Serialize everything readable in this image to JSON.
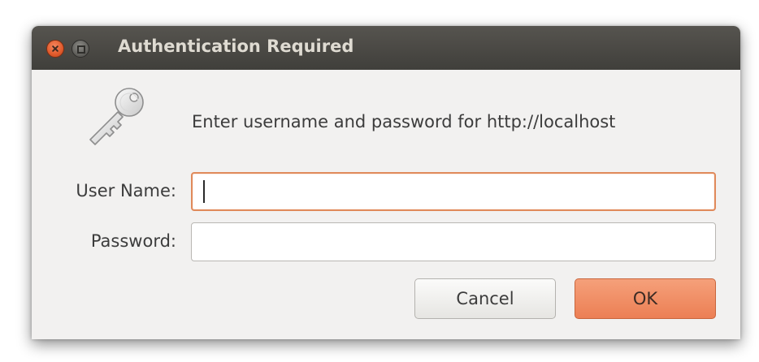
{
  "window": {
    "title": "Authentication Required"
  },
  "icons": {
    "close": "close-icon",
    "maximize": "maximize-icon",
    "key": "key-icon"
  },
  "message": "Enter username and password for http://localhost",
  "form": {
    "username_label": "User Name:",
    "username_value": "",
    "password_label": "Password:",
    "password_value": ""
  },
  "buttons": {
    "cancel": "Cancel",
    "ok": "OK"
  },
  "colors": {
    "titlebar": "#403f3b",
    "dialog_bg": "#f2f1f0",
    "accent": "#ec7f54",
    "focus_border": "#e08a5b"
  }
}
